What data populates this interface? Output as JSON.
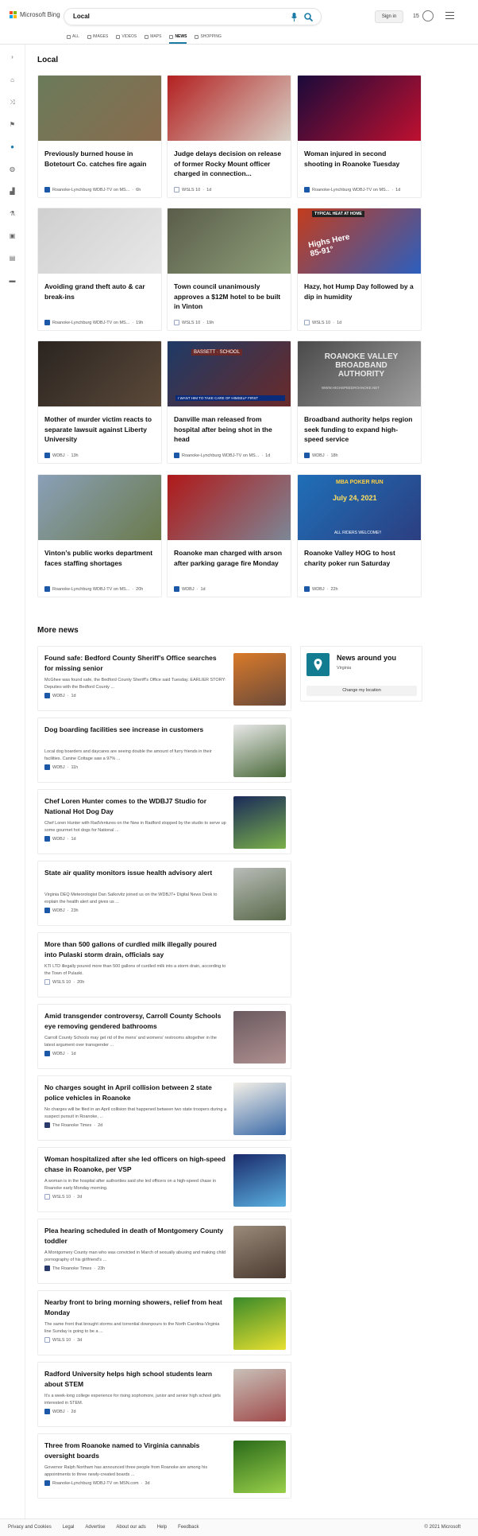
{
  "header": {
    "brand": "Microsoft Bing",
    "query": "Local",
    "signin": "Sign in",
    "rewards_count": "15",
    "logo_colors": [
      "#f25022",
      "#7fba00",
      "#00a4ef",
      "#ffb900"
    ],
    "accent": "#1a7ba7"
  },
  "tabs": [
    {
      "label": "ALL",
      "icon": "search-icon"
    },
    {
      "label": "IMAGES",
      "icon": "image-icon"
    },
    {
      "label": "VIDEOS",
      "icon": "video-icon"
    },
    {
      "label": "MAPS",
      "icon": "map-icon"
    },
    {
      "label": "NEWS",
      "icon": "news-icon",
      "active": true
    },
    {
      "label": "SHOPPING",
      "icon": "shopping-icon"
    }
  ],
  "sections": {
    "local": "Local",
    "more": "More news"
  },
  "cards": [
    {
      "title": "Previously burned house in Botetourt Co. catches fire again",
      "source": "Roanoke-Lynchburg WDBJ-TV on MS...",
      "time": "6h",
      "src": "wd",
      "colors": [
        "#6a7b5a",
        "#8a6b4e"
      ]
    },
    {
      "title": "Judge delays decision on release of former Rocky Mount officer charged in connection...",
      "source": "WSLS 10",
      "time": "1d",
      "src": "ws",
      "colors": [
        "#b32020",
        "#d8d2c8"
      ]
    },
    {
      "title": "Woman injured in second shooting in Roanoke Tuesday",
      "source": "Roanoke-Lynchburg WDBJ-TV on MS...",
      "time": "1d",
      "src": "wd",
      "colors": [
        "#1a0a3a",
        "#c01030"
      ]
    },
    {
      "title": "Avoiding grand theft auto & car break-ins",
      "source": "Roanoke-Lynchburg WDBJ-TV on MS...",
      "time": "19h",
      "src": "wd",
      "colors": [
        "#cfcfcf",
        "#e8e8e8"
      ]
    },
    {
      "title": "Town council unanimously approves a $12M hotel to be built in Vinton",
      "source": "WSLS 10",
      "time": "19h",
      "src": "ws",
      "colors": [
        "#5a5d4a",
        "#8fa07a"
      ]
    },
    {
      "title": "Hazy, hot Hump Day followed by a dip in humidity",
      "source": "WSLS 10",
      "time": "1d",
      "src": "ws",
      "colors": [
        "#c43c1c",
        "#2a5fc0"
      ]
    },
    {
      "title": "Mother of murder victim reacts to separate lawsuit against Liberty University",
      "source": "WDBJ",
      "time": "13h",
      "src": "wd",
      "colors": [
        "#2a2420",
        "#5c4a3a"
      ]
    },
    {
      "title": "Danville man released from hospital after being shot in the head",
      "source": "Roanoke-Lynchburg WDBJ-TV on MS...",
      "time": "1d",
      "src": "wd",
      "colors": [
        "#1e3a66",
        "#6a2a2a"
      ]
    },
    {
      "title": "Broadband authority helps region seek funding to expand high-speed service",
      "source": "WDBJ",
      "time": "18h",
      "src": "wd",
      "colors": [
        "#4a4a4a",
        "#a0a0a0"
      ]
    },
    {
      "title": "Vinton’s public works department faces staffing shortages",
      "source": "Roanoke-Lynchburg WDBJ-TV on MS...",
      "time": "20h",
      "src": "wd",
      "colors": [
        "#8aa0b8",
        "#6a7a4a"
      ]
    },
    {
      "title": "Roanoke man charged with arson after parking garage fire Monday",
      "source": "WDBJ",
      "time": "1d",
      "src": "wd",
      "colors": [
        "#b01818",
        "#7c8898"
      ]
    },
    {
      "title": "Roanoke Valley HOG to host charity poker run Saturday",
      "source": "WDBJ",
      "time": "22h",
      "src": "wd",
      "colors": [
        "#1f6fb8",
        "#2c3e80"
      ]
    }
  ],
  "overlay_text": {
    "card5_weather": "Highs Here 85-91°",
    "card5_banner": "TYPICAL HEAT AT HOME",
    "card8_sign": "ROANOKE VALLEY BROADBAND AUTHORITY",
    "card8_url": "WWW.HIGHSPEEDROANOKE.NET",
    "card7_sign": "BASSETT · SCHOOL",
    "card7_banner": "I WANT HIM TO TAKE CARE OF HIMSELF FIRST",
    "card12_date": "July 24, 2021",
    "card12_title": "MBA POKER RUN",
    "card12_footer": "ALL RIDERS WELCOME!!"
  },
  "more_news": [
    {
      "title": "Found safe: Bedford County Sheriff’s Office searches for missing senior",
      "snippet": "McGhee was found safe, the Bedford County Sheriff’s Office said Tuesday. EARLIER STORY: Deputies with the Bedford County ...",
      "source": "WDBJ",
      "time": "1d",
      "src": "wd",
      "thumb": [
        "#d97a2a",
        "#6a4a3a"
      ]
    },
    {
      "title": "Dog boarding facilities see increase in customers",
      "snippet": "Local dog boarders and daycares are seeing double the amount of furry friends in their facilities. Canine Cottage saw a 97% ...",
      "source": "WDBJ",
      "time": "11h",
      "src": "wd",
      "thumb": [
        "#e8e8e8",
        "#4a6a3a"
      ]
    },
    {
      "title": "Chef Loren Hunter comes to the WDBJ7 Studio for National Hot Dog Day",
      "snippet": "Chef Loren Hunter with RadVentures on the New in Radford stopped by the studio to serve up some gourmet hot dogs for National ...",
      "source": "WDBJ",
      "time": "1d",
      "src": "wd",
      "thumb": [
        "#1a2a5a",
        "#7ab04a"
      ]
    },
    {
      "title": "State air quality monitors issue health advisory alert",
      "snippet": "Virginia DEQ Meteorologist Dan Salkovitz joined us on the WDBJ7+ Digital News Desk to explain the health alert and gives us ...",
      "source": "WDBJ",
      "time": "23h",
      "src": "wd",
      "thumb": [
        "#b8bcb8",
        "#5a6a4a"
      ]
    },
    {
      "title": "More than 500 gallons of curdled milk illegally poured into Pulaski storm drain, officials say",
      "snippet": "KTI LTD illegally poured more than 500 gallons of curdled milk into a storm drain, according to the Town of Pulaski.",
      "source": "WSLS 10",
      "time": "20h",
      "src": "ws",
      "thumb": null
    },
    {
      "title": "Amid transgender controversy, Carroll County Schools eye removing gendered bathrooms",
      "snippet": "Carroll County Schools may get rid of the mens’ and womens’ restrooms altogether in the latest argument over transgender ...",
      "source": "WDBJ",
      "time": "1d",
      "src": "wd",
      "thumb": [
        "#6a5a60",
        "#b09090"
      ]
    },
    {
      "title": "No charges sought in April collision between 2 state police vehicles in Roanoke",
      "snippet": "No charges will be filed in an April collision that happened between two state troopers during a suspect pursuit in Roanoke, ...",
      "source": "The Roanoke Times",
      "time": "2d",
      "src": "rt",
      "thumb": [
        "#f4f0e8",
        "#3a6aa8"
      ]
    },
    {
      "title": "Woman hospitalized after she led officers on high-speed chase in Roanoke, per VSP",
      "snippet": "A woman is in the hospital after authorities said she led officers on a high-speed chase in Roanoke early Monday morning.",
      "source": "WSLS 10",
      "time": "2d",
      "src": "ws",
      "thumb": [
        "#1a2a6a",
        "#5ab0e0"
      ]
    },
    {
      "title": "Plea hearing scheduled in death of Montgomery County toddler",
      "snippet": "A Montgomery County man who was convicted in March of sexually abusing and making child pornography of his girlfriend’s ...",
      "source": "The Roanoke Times",
      "time": "23h",
      "src": "rt",
      "thumb": [
        "#9a8a7a",
        "#4a3a30"
      ]
    },
    {
      "title": "Nearby front to bring morning showers, relief from heat Monday",
      "snippet": "The same front that brought storms and torrential downpours to the North Carolina-Virginia line Sunday is going to be a ...",
      "source": "WSLS 10",
      "time": "3d",
      "src": "ws",
      "thumb": [
        "#3a8a2a",
        "#e8e030"
      ]
    },
    {
      "title": "Radford University helps high school students learn about STEM",
      "snippet": "It’s a week-long college experience for rising sophomore, junior and senior high school girls interested in STEM.",
      "source": "WDBJ",
      "time": "2d",
      "src": "wd",
      "thumb": [
        "#c8c0b8",
        "#a04a4a"
      ]
    },
    {
      "title": "Three from Roanoke named to Virginia cannabis oversight boards",
      "snippet": "Governor Ralph Northam has announced three people from Roanoke are among his appointments to three newly-created boards ...",
      "source": "Roanoke-Lynchburg WDBJ-TV on MSN.com",
      "time": "3d",
      "src": "wd",
      "thumb": [
        "#2a6a1a",
        "#9ad04a"
      ]
    }
  ],
  "news_around": {
    "title": "News around you",
    "location": "Virginia",
    "button": "Change my location"
  },
  "footer": {
    "links": [
      "Privacy and Cookies",
      "Legal",
      "Advertise",
      "About our ads",
      "Help",
      "Feedback"
    ],
    "copyright": "© 2021 Microsoft"
  }
}
